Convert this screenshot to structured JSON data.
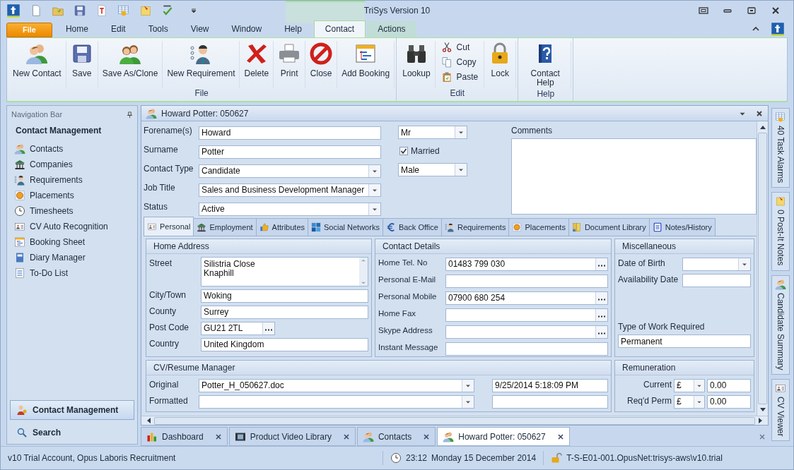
{
  "window": {
    "title": "TriSys Version 10"
  },
  "menu": [
    {
      "label": "File",
      "kind": "file",
      "selected": false
    },
    {
      "label": "Home",
      "kind": "tab",
      "selected": false
    },
    {
      "label": "Edit",
      "kind": "tab",
      "selected": false
    },
    {
      "label": "Tools",
      "kind": "tab",
      "selected": false
    },
    {
      "label": "View",
      "kind": "tab",
      "selected": false
    },
    {
      "label": "Window",
      "kind": "tab",
      "selected": false
    },
    {
      "label": "Help",
      "kind": "tab",
      "selected": false
    },
    {
      "label": "Contact",
      "kind": "context",
      "selected": true
    },
    {
      "label": "Actions",
      "kind": "context",
      "selected": false
    }
  ],
  "ribbon": [
    {
      "label": "File",
      "buttons": [
        {
          "label": "New Contact",
          "kind": "large"
        },
        {
          "label": "Save",
          "kind": "large"
        },
        {
          "label": "Save As/Clone",
          "kind": "large"
        },
        {
          "label": "New Requirement",
          "kind": "large"
        },
        {
          "label": "Delete",
          "kind": "large"
        },
        {
          "label": "Print",
          "kind": "large"
        },
        {
          "label": "Close",
          "kind": "large"
        },
        {
          "label": "Add Booking",
          "kind": "large"
        }
      ]
    },
    {
      "label": "Edit",
      "buttons": [
        {
          "label": "Lookup",
          "kind": "large"
        },
        {
          "label": "Cut",
          "kind": "small"
        },
        {
          "label": "Copy",
          "kind": "small"
        },
        {
          "label": "Paste",
          "kind": "small"
        },
        {
          "label": "Lock",
          "kind": "large"
        }
      ]
    },
    {
      "label": "Help",
      "buttons": [
        {
          "label": "Contact Help",
          "kind": "large"
        }
      ]
    }
  ],
  "nav": {
    "title": "Navigation Bar",
    "heading": "Contact Management",
    "items": [
      "Contacts",
      "Companies",
      "Requirements",
      "Placements",
      "Timesheets",
      "CV Auto Recognition",
      "Booking Sheet",
      "Diary Manager",
      "To-Do List"
    ],
    "buttons": [
      {
        "label": "Contact Management",
        "selected": true
      },
      {
        "label": "Search",
        "selected": false
      }
    ]
  },
  "record": {
    "title": "Howard Potter: 050627",
    "fields": [
      {
        "label": "Forename(s)",
        "value": "Howard",
        "kind": "text"
      },
      {
        "label": "Surname",
        "value": "Potter",
        "kind": "text"
      },
      {
        "label": "Contact Type",
        "value": "Candidate",
        "kind": "dropdown"
      },
      {
        "label": "Job Title",
        "value": "Sales and Business Development Manager",
        "kind": "dropdown"
      },
      {
        "label": "Status",
        "value": "Active",
        "kind": "dropdown"
      }
    ],
    "salutation": {
      "value": "Mr"
    },
    "married": {
      "label": "Married",
      "checked": true
    },
    "gender": {
      "value": "Male"
    },
    "comments": {
      "label": "Comments"
    }
  },
  "tabs": [
    {
      "label": "Personal",
      "selected": true
    },
    {
      "label": "Employment",
      "selected": false
    },
    {
      "label": "Attributes",
      "selected": false
    },
    {
      "label": "Social Networks",
      "selected": false
    },
    {
      "label": "Back Office",
      "selected": false
    },
    {
      "label": "Requirements",
      "selected": false
    },
    {
      "label": "Placements",
      "selected": false
    },
    {
      "label": "Document Library",
      "selected": false
    },
    {
      "label": "Notes/History",
      "selected": false
    }
  ],
  "sections": [
    {
      "title": "Home Address",
      "fields": [
        {
          "label": "Street",
          "kind": "multiline",
          "lines": [
            "Silistria Close",
            "Knaphill"
          ]
        },
        {
          "label": "City/Town",
          "value": "Woking",
          "kind": "text"
        },
        {
          "label": "County",
          "value": "Surrey",
          "kind": "text"
        },
        {
          "label": "Post Code",
          "value": "GU21 2TL",
          "kind": "short"
        },
        {
          "label": "Country",
          "value": "United Kingdom",
          "kind": "text"
        }
      ]
    },
    {
      "title": "Contact Details",
      "fields": [
        {
          "label": "Home Tel. No",
          "value": "01483 799 030",
          "kind": "ellipsis"
        },
        {
          "label": "Personal E-Mail",
          "kind": "text"
        },
        {
          "label": "Personal Mobile",
          "value": "07900 680 254",
          "kind": "ellipsis"
        },
        {
          "label": "Home Fax",
          "kind": "ellipsis"
        },
        {
          "label": "Skype Address",
          "kind": "ellipsis"
        },
        {
          "label": "Instant Message",
          "kind": "text"
        }
      ]
    },
    {
      "title": "Miscellaneous",
      "fields": [
        {
          "label": "Date of Birth",
          "kind": "dropdown"
        },
        {
          "label": "Availability Date",
          "kind": "text"
        },
        {
          "label": "Type of Work Required",
          "value": "Permanent",
          "kind": "stacked"
        }
      ]
    }
  ],
  "cv": {
    "title": "CV/Resume Manager",
    "rows": [
      {
        "label": "Original",
        "value": "Potter_H_050627.doc",
        "date": "9/25/2014 5:18:09 PM"
      },
      {
        "label": "Formatted"
      }
    ]
  },
  "remuneration": {
    "title": "Remuneration",
    "rows": [
      {
        "label": "Current",
        "currency": "£",
        "amount": "0.00"
      },
      {
        "label": "Req'd Perm",
        "currency": "£",
        "amount": "0.00"
      }
    ]
  },
  "doc_tabs": [
    {
      "label": "Dashboard",
      "selected": false
    },
    {
      "label": "Product Video Library",
      "selected": false
    },
    {
      "label": "Contacts",
      "selected": false
    },
    {
      "label": "Howard Potter: 050627",
      "selected": true
    }
  ],
  "side_panels": [
    "40 Task Alarms",
    "0 Post-It Notes",
    "Candidate Summary",
    "CV Viewer"
  ],
  "status_bar": {
    "account": "v10 Trial Account, Opus Laboris Recruitment",
    "time": "23:12",
    "date": "Monday 15 December 2014",
    "server": "T-S-E01-001.OpusNet:trisys-aws\\v10.trial"
  }
}
